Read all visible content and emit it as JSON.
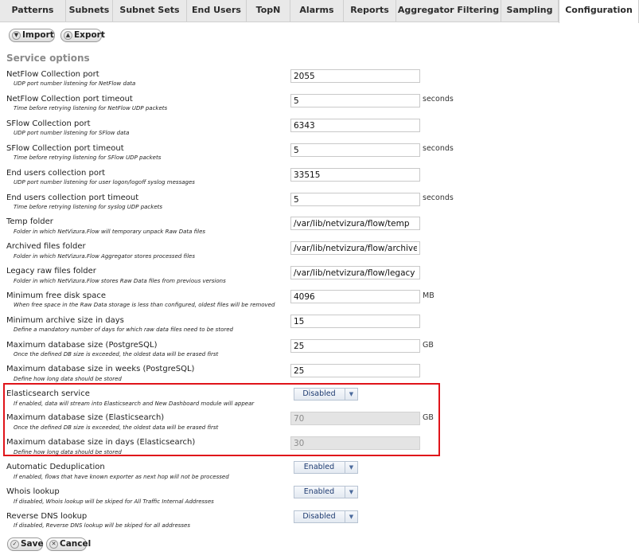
{
  "tabs": [
    {
      "label": "Patterns",
      "active": false
    },
    {
      "label": "Subnets",
      "active": false
    },
    {
      "label": "Subnet Sets",
      "active": false
    },
    {
      "label": "End Users",
      "active": false
    },
    {
      "label": "TopN",
      "active": false
    },
    {
      "label": "Alarms",
      "active": false
    },
    {
      "label": "Reports",
      "active": false
    },
    {
      "label": "Aggregator Filtering",
      "active": false
    },
    {
      "label": "Sampling",
      "active": false
    },
    {
      "label": "Configuration",
      "active": true
    }
  ],
  "toolbar": {
    "import_label": "Import",
    "export_label": "Export"
  },
  "section_title": "Service options",
  "settings": [
    {
      "label": "NetFlow Collection port",
      "desc": "UDP port number listening for NetFlow data",
      "value": "2055",
      "unit": ""
    },
    {
      "label": "NetFlow Collection port timeout",
      "desc": "Time before retrying listening for NetFlow UDP packets",
      "value": "5",
      "unit": "seconds"
    },
    {
      "label": "SFlow Collection port",
      "desc": "UDP port number listening for SFlow data",
      "value": "6343",
      "unit": ""
    },
    {
      "label": "SFlow Collection port timeout",
      "desc": "Time before retrying listening for SFlow UDP packets",
      "value": "5",
      "unit": "seconds"
    },
    {
      "label": "End users collection port",
      "desc": "UDP port number listening for user logon/logoff syslog messages",
      "value": "33515",
      "unit": ""
    },
    {
      "label": "End users collection port timeout",
      "desc": "Time before retrying listening for syslog UDP packets",
      "value": "5",
      "unit": "seconds"
    },
    {
      "label": "Temp folder",
      "desc": "Folder in which NetVizura.Flow will temporary unpack Raw Data files",
      "value": "/var/lib/netvizura/flow/temp",
      "unit": ""
    },
    {
      "label": "Archived files folder",
      "desc": "Folder in which NetVizura.Flow Aggregator stores processed files",
      "value": "/var/lib/netvizura/flow/archive",
      "unit": ""
    },
    {
      "label": "Legacy raw files folder",
      "desc": "Folder in which NetVizura.Flow stores Raw Data files from previous versions",
      "value": "/var/lib/netvizura/flow/legacy",
      "unit": ""
    },
    {
      "label": "Minimum free disk space",
      "desc": "When free space in the Raw Data storage is less than configured, oldest files will be removed",
      "value": "4096",
      "unit": "MB"
    },
    {
      "label": "Minimum archive size in days",
      "desc": "Define a mandatory number of days for which raw data files need to be stored",
      "value": "15",
      "unit": ""
    },
    {
      "label": "Maximum database size (PostgreSQL)",
      "desc": "Once the defined DB size is exceeded, the oldest data will be erased first",
      "value": "25",
      "unit": "GB"
    },
    {
      "label": "Maximum database size in weeks (PostgreSQL)",
      "desc": "Define how long data should be stored",
      "value": "25",
      "unit": ""
    }
  ],
  "elastic": {
    "service_label": "Elasticsearch service",
    "service_desc": "If enabled, data will stream into Elasticsearch and New Dashboard module will appear",
    "service_value": "Disabled",
    "size_label": "Maximum database size (Elasticsearch)",
    "size_desc": "Once the defined DB size is exceeded, the oldest data will be erased first",
    "size_value": "70",
    "size_unit": "GB",
    "days_label": "Maximum database size in days (Elasticsearch)",
    "days_desc": "Define how long data should be stored",
    "days_value": "30"
  },
  "toggles": [
    {
      "label": "Automatic Deduplication",
      "desc": "If enabled, flows that have known exporter as next hop will not be processed",
      "value": "Enabled"
    },
    {
      "label": "Whois lookup",
      "desc": "If disabled, Whois lookup will be skiped for All Traffic Internal Addresses",
      "value": "Enabled"
    },
    {
      "label": "Reverse DNS lookup",
      "desc": "If disabled, Reverse DNS lookup will be skiped for all addresses",
      "value": "Disabled"
    }
  ],
  "footer": {
    "save_label": "Save",
    "cancel_label": "Cancel"
  },
  "colors": {
    "highlight": "#e0141a",
    "section_title": "#8a8a8a"
  }
}
